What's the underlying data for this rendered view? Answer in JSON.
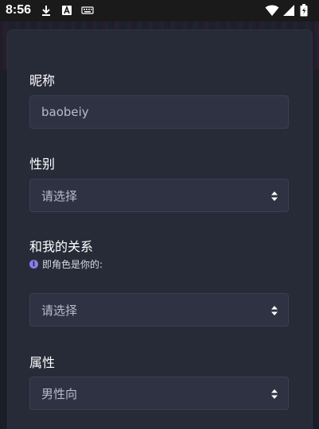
{
  "status_bar": {
    "time": "8:56",
    "left_icons": [
      "download-icon",
      "font-a-icon",
      "keyboard-icon"
    ],
    "right_icons": [
      "wifi-icon",
      "signal-icon",
      "battery-icon"
    ]
  },
  "form": {
    "nickname": {
      "label": "昵称",
      "value": "baobeiy"
    },
    "gender": {
      "label": "性别",
      "selected": "请选择"
    },
    "relationship": {
      "label": "和我的关系",
      "hint": "即角色是你的:",
      "selected": "请选择"
    },
    "attribute": {
      "label": "属性",
      "selected": "男性向"
    }
  },
  "colors": {
    "card_bg": "#272b38",
    "input_bg": "#2e3243",
    "accent_info": "#8a7cf0"
  }
}
